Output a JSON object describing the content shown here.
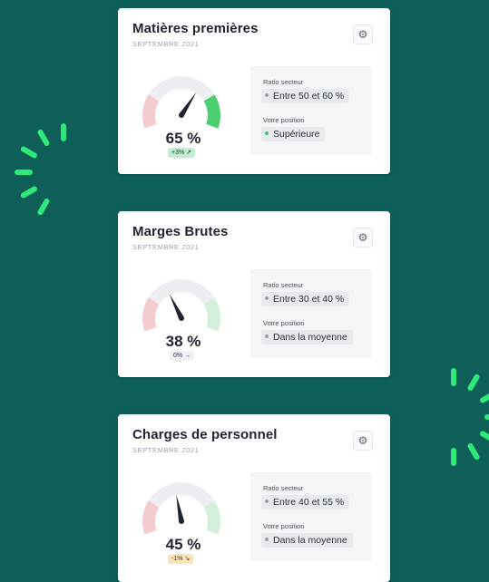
{
  "cards": [
    {
      "title": "Matières premières",
      "date": "SEPTEMBRE 2021",
      "percent_label": "65 %",
      "percent_value": 65,
      "delta": "+3% ↗",
      "delta_color": "#bfeed0",
      "ratio_label": "Ratio secteur",
      "ratio_value": "Entre 50 et 60 %",
      "position_label": "Votre position",
      "position_value": "Supérieure",
      "position_dot_color": "#3cc46e",
      "right_zone_color": "#4ccf71",
      "left_zone_color": "#f3cdcd"
    },
    {
      "title": "Marges Brutes",
      "date": "SEPTEMBRE 2021",
      "percent_label": "38 %",
      "percent_value": 38,
      "delta": "0% →",
      "delta_color": "#eef0f3",
      "ratio_label": "Ratio secteur",
      "ratio_value": "Entre 30 et 40 %",
      "position_label": "Votre position",
      "position_value": "Dans la moyenne",
      "position_dot_color": "#9aa0aa",
      "right_zone_color": "#d2f0dc",
      "left_zone_color": "#f3cdcd"
    },
    {
      "title": "Charges de personnel",
      "date": "SEPTEMBRE 2021",
      "percent_label": "45 %",
      "percent_value": 45,
      "delta": "-1% ↘",
      "delta_color": "#fbe3b8",
      "ratio_label": "Ratio secteur",
      "ratio_value": "Entre 40 et 55 %",
      "position_label": "Votre position",
      "position_value": "Dans la moyenne",
      "position_dot_color": "#9aa0aa",
      "right_zone_color": "#d2f0dc",
      "left_zone_color": "#f3cdcd"
    }
  ],
  "icons": {
    "settings": "gear-icon"
  },
  "colors": {
    "background": "#0d5f58",
    "accent_burst": "#2ee87a"
  }
}
